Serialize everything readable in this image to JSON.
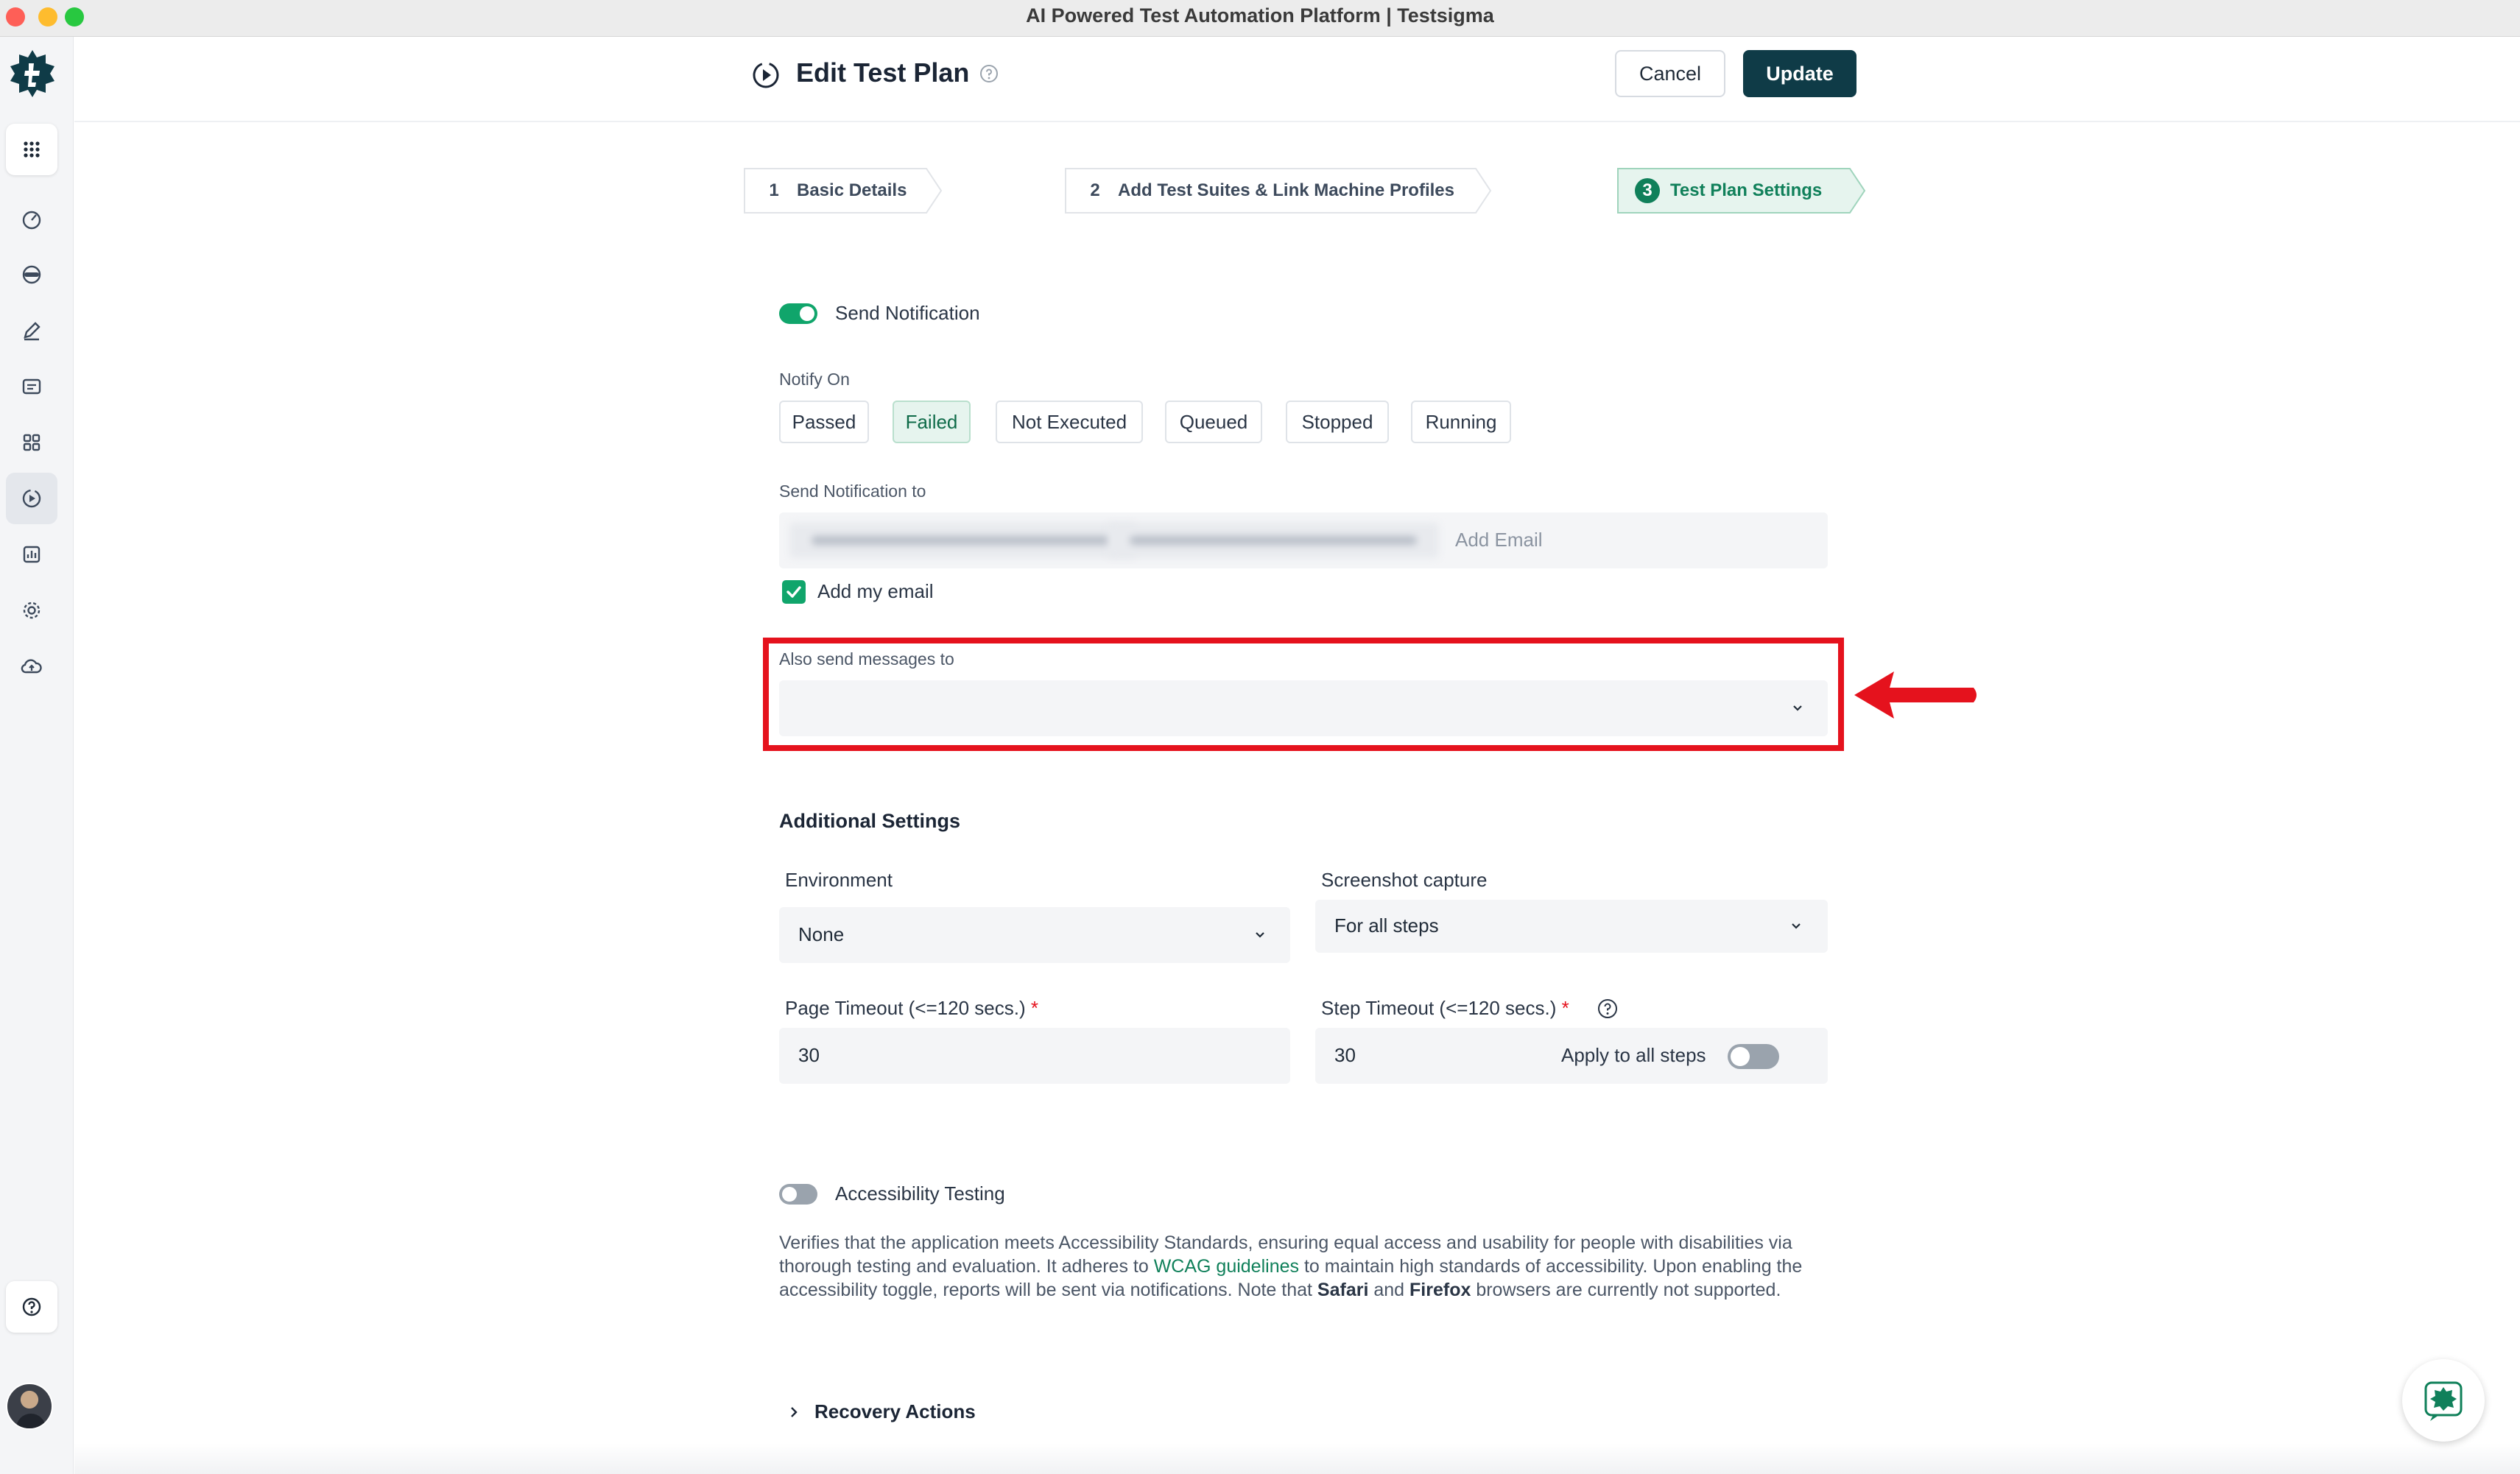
{
  "window": {
    "title": "AI Powered Test Automation Platform | Testsigma"
  },
  "header": {
    "title": "Edit Test Plan",
    "cancel_label": "Cancel",
    "update_label": "Update"
  },
  "steps": [
    {
      "number": "1",
      "label": "Basic Details"
    },
    {
      "number": "2",
      "label": "Add Test Suites & Link Machine Profiles"
    },
    {
      "number": "3",
      "label": "Test Plan Settings"
    }
  ],
  "notification": {
    "toggle_label": "Send Notification",
    "enabled": true,
    "notify_on_label": "Notify On",
    "options": [
      "Passed",
      "Failed",
      "Not Executed",
      "Queued",
      "Stopped",
      "Running"
    ],
    "selected": "Failed",
    "send_to_label": "Send Notification to",
    "add_email_placeholder": "Add Email",
    "add_my_email_label": "Add my email",
    "add_my_email_checked": true,
    "also_send_label": "Also send messages to",
    "also_send_value": ""
  },
  "additional": {
    "title": "Additional Settings",
    "environment_label": "Environment",
    "environment_value": "None",
    "screenshot_label": "Screenshot capture",
    "screenshot_value": "For all steps",
    "page_timeout_label": "Page Timeout (<=120 secs.)",
    "page_timeout_value": "30",
    "step_timeout_label": "Step Timeout (<=120 secs.)",
    "step_timeout_value": "30",
    "apply_all_label": "Apply to all steps",
    "apply_all_enabled": false,
    "required_mark": "*"
  },
  "accessibility": {
    "label": "Accessibility Testing",
    "enabled": false,
    "desc_1": "Verifies that the application meets Accessibility Standards, ensuring equal access and usability for people with disabilities via thorough testing and evaluation. It adheres to ",
    "desc_link": "WCAG guidelines",
    "desc_2": " to maintain high standards of accessibility. Upon enabling the accessibility toggle, reports will be sent via notifications. Note that ",
    "desc_safari": "Safari",
    "desc_and": " and ",
    "desc_firefox": "Firefox",
    "desc_3": " browsers are currently not supported."
  },
  "recovery": {
    "label": "Recovery Actions"
  },
  "colors": {
    "brand": "#0f3b47",
    "accent": "#10a56b",
    "highlight": "#e5121d"
  },
  "icons": [
    "testsigma-logo-icon",
    "apps-grid-icon",
    "dashboard-gauge-icon",
    "agent-icon",
    "pencil-icon",
    "folder-icon",
    "modules-grid-icon",
    "play-circle-icon",
    "report-chart-icon",
    "gear-icon",
    "cloud-upload-icon",
    "help-circle-icon",
    "chevron-down-icon",
    "chevron-right-icon",
    "check-icon",
    "arrow-left-icon",
    "chat-bot-icon"
  ]
}
